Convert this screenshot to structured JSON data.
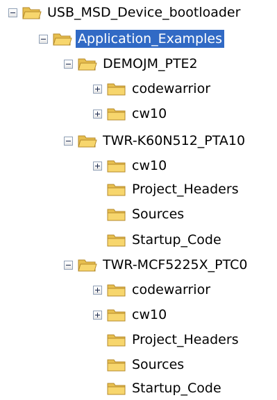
{
  "tree": {
    "nodes": [
      {
        "label": "USB_MSD_Device_bootloader",
        "toggle": "minus",
        "level": 0,
        "selected": false
      },
      {
        "label": "Application_Examples",
        "toggle": "minus",
        "level": 1,
        "selected": true
      },
      {
        "label": "DEMOJM_PTE2",
        "toggle": "minus",
        "level": 2,
        "selected": false
      },
      {
        "label": "codewarrior",
        "toggle": "plus",
        "level": 3,
        "selected": false
      },
      {
        "label": "cw10",
        "toggle": "plus",
        "level": 3,
        "selected": false
      },
      {
        "label": "TWR-K60N512_PTA10",
        "toggle": "minus",
        "level": 2,
        "selected": false
      },
      {
        "label": "cw10",
        "toggle": "plus",
        "level": 3,
        "selected": false
      },
      {
        "label": "Project_Headers",
        "toggle": "none",
        "level": 3,
        "selected": false
      },
      {
        "label": "Sources",
        "toggle": "none",
        "level": 3,
        "selected": false
      },
      {
        "label": "Startup_Code",
        "toggle": "none",
        "level": 3,
        "selected": false
      },
      {
        "label": "TWR-MCF5225X_PTC0",
        "toggle": "minus",
        "level": 2,
        "selected": false
      },
      {
        "label": "codewarrior",
        "toggle": "plus",
        "level": 3,
        "selected": false
      },
      {
        "label": "cw10",
        "toggle": "plus",
        "level": 3,
        "selected": false
      },
      {
        "label": "Project_Headers",
        "toggle": "none",
        "level": 3,
        "selected": false
      },
      {
        "label": "Sources",
        "toggle": "none",
        "level": 3,
        "selected": false
      },
      {
        "label": "Startup_Code",
        "toggle": "none",
        "level": 3,
        "selected": false
      }
    ]
  },
  "colors": {
    "selection": "#316ac5",
    "folder_body": "#f7d66d",
    "folder_outline": "#b48a2b"
  }
}
